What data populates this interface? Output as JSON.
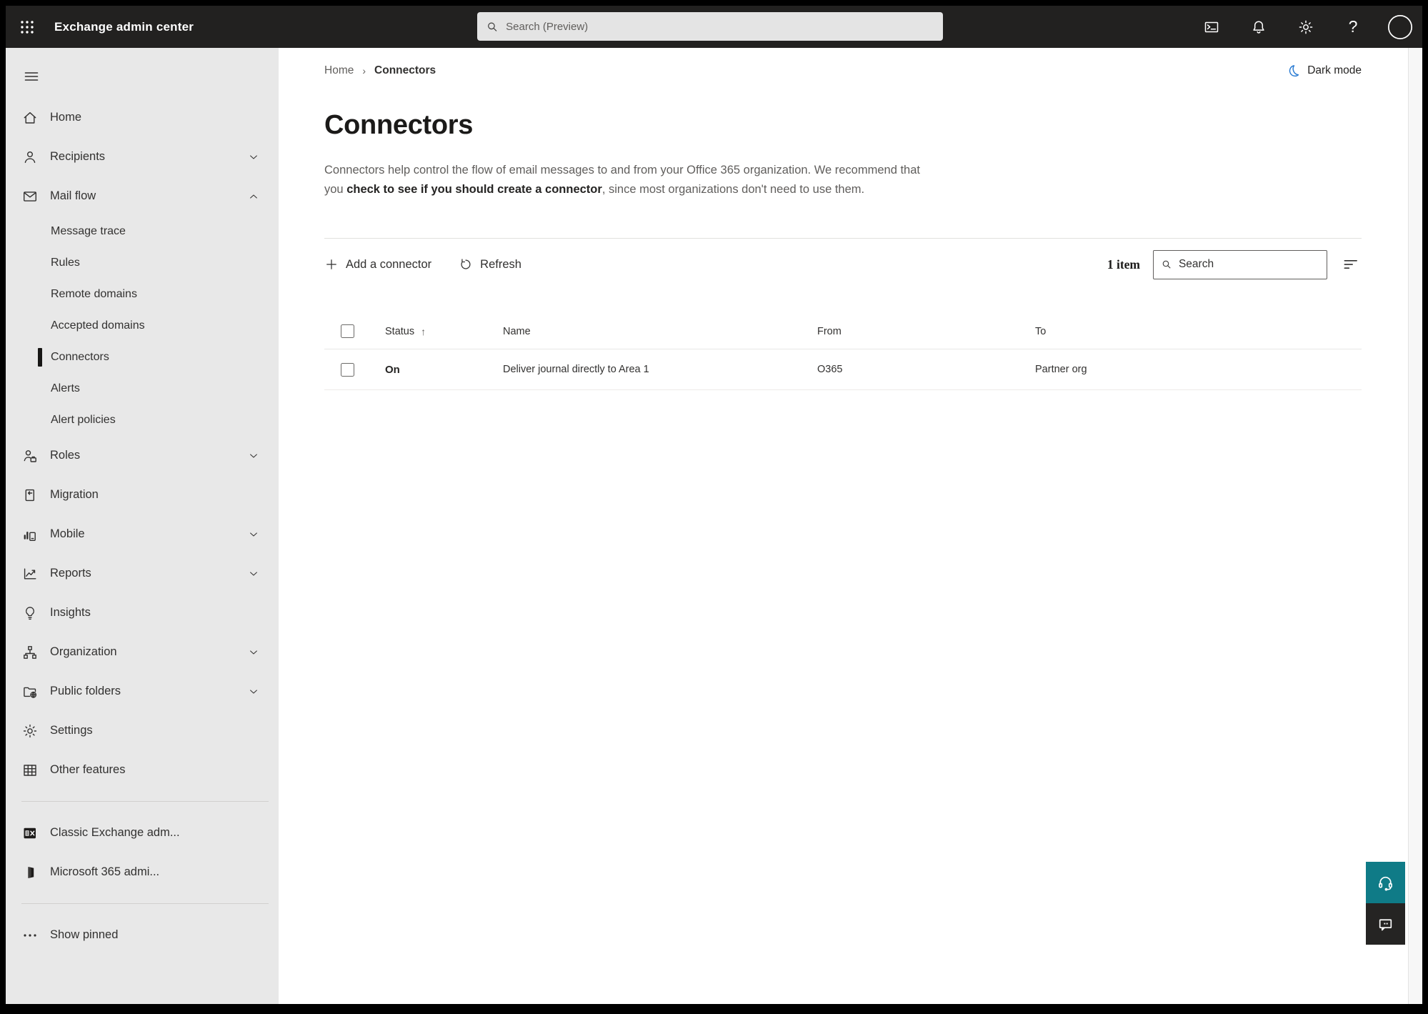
{
  "topbar": {
    "title": "Exchange admin center",
    "search_placeholder": "Search (Preview)"
  },
  "breadcrumb": {
    "home": "Home",
    "separator": "›",
    "current": "Connectors"
  },
  "dark_mode_label": "Dark mode",
  "page": {
    "title": "Connectors",
    "description_pre": "Connectors help control the flow of email messages to and from your Office 365 organization. We recommend that you ",
    "description_link": "check to see if you should create a connector",
    "description_post": ", since most organizations don't need to use them."
  },
  "toolbar": {
    "add_label": "Add a connector",
    "refresh_label": "Refresh",
    "count_label": "1 item",
    "search_placeholder": "Search"
  },
  "table": {
    "columns": {
      "status": "Status",
      "name": "Name",
      "from": "From",
      "to": "To"
    },
    "sorted_by": "Status",
    "sort_direction_glyph": "↑",
    "rows": [
      {
        "status": "On",
        "name": "Deliver journal directly to Area 1",
        "from": "O365",
        "to": "Partner org"
      }
    ]
  },
  "sidebar": {
    "items": [
      {
        "label": "Home",
        "icon": "home",
        "type": "top"
      },
      {
        "label": "Recipients",
        "icon": "person",
        "type": "top",
        "chevron": "down"
      },
      {
        "label": "Mail flow",
        "icon": "mail",
        "type": "top",
        "chevron": "up"
      },
      {
        "label": "Message trace",
        "type": "sub"
      },
      {
        "label": "Rules",
        "type": "sub"
      },
      {
        "label": "Remote domains",
        "type": "sub"
      },
      {
        "label": "Accepted domains",
        "type": "sub"
      },
      {
        "label": "Connectors",
        "type": "sub",
        "selected": true
      },
      {
        "label": "Alerts",
        "type": "sub"
      },
      {
        "label": "Alert policies",
        "type": "sub"
      },
      {
        "label": "Roles",
        "icon": "roles",
        "type": "top",
        "chevron": "down"
      },
      {
        "label": "Migration",
        "icon": "migration",
        "type": "top"
      },
      {
        "label": "Mobile",
        "icon": "mobile",
        "type": "top",
        "chevron": "down"
      },
      {
        "label": "Reports",
        "icon": "reports",
        "type": "top",
        "chevron": "down"
      },
      {
        "label": "Insights",
        "icon": "insights",
        "type": "top"
      },
      {
        "label": "Organization",
        "icon": "organization",
        "type": "top",
        "chevron": "down"
      },
      {
        "label": "Public folders",
        "icon": "public-folders",
        "type": "top",
        "chevron": "down"
      },
      {
        "label": "Settings",
        "icon": "gear",
        "type": "top"
      },
      {
        "label": "Other features",
        "icon": "grid",
        "type": "top"
      },
      {
        "type": "divider"
      },
      {
        "label": "Classic Exchange adm...",
        "icon": "exchange-logo",
        "type": "top"
      },
      {
        "label": "Microsoft 365 admi...",
        "icon": "office-logo",
        "type": "top"
      },
      {
        "type": "divider"
      },
      {
        "label": "Show pinned",
        "icon": "ellipsis",
        "type": "top"
      }
    ]
  },
  "icons": {
    "app-launcher-icon": "3x3 dot grid",
    "terminal-icon": "console window >_",
    "notifications-icon": "bell",
    "settings-icon": "gear",
    "help-icon": "?",
    "avatar-icon": "empty circle",
    "search-icon": "magnifier",
    "dark-mode-icon": "crescent moon",
    "add-icon": "+",
    "refresh-icon": "circular arrow",
    "filter-icon": "decreasing lines",
    "sort-ascending-icon": "↑",
    "support-icon": "headset",
    "feedback-icon": "speech bubble"
  },
  "colors": {
    "topbar_bg": "#222120",
    "sidebar_bg": "#e8e8e8",
    "accent_moon": "#2b7cd3",
    "support_teal": "#0f7b87",
    "feedback_dark": "#252423",
    "text_primary": "#323130",
    "text_secondary": "#605e5c"
  }
}
